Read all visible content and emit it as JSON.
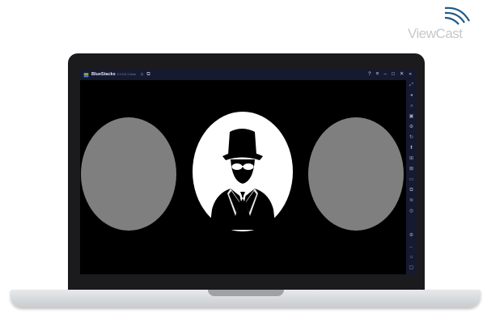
{
  "watermark": {
    "text": "ViewCast"
  },
  "window": {
    "title": "BlueStacks",
    "version": "5.9.110.1 Beta",
    "left_icons": [
      "home-icon",
      "multi-instance-icon"
    ],
    "right_icons": [
      "help-icon",
      "menu-icon",
      "minimize-icon",
      "maximize-icon",
      "close-icon",
      "collapse-sidebar-icon"
    ]
  },
  "sidebar": {
    "items": [
      {
        "name": "fullscreen-icon",
        "glyph": "⤢"
      },
      {
        "name": "volume-up-icon",
        "glyph": "◂"
      },
      {
        "name": "volume-down-icon",
        "glyph": "◃"
      },
      {
        "name": "media-icon",
        "glyph": "▣"
      },
      {
        "name": "settings-small-icon",
        "glyph": "⚙"
      },
      {
        "name": "rotate-icon",
        "glyph": "↻"
      },
      {
        "name": "apk-install-icon",
        "glyph": "⬆"
      },
      {
        "name": "screenshot-icon",
        "glyph": "⊞"
      },
      {
        "name": "shake-icon",
        "glyph": "⊠"
      },
      {
        "name": "folder-icon",
        "glyph": "▭"
      },
      {
        "name": "copy-icon",
        "glyph": "⧉"
      },
      {
        "name": "layers-icon",
        "glyph": "≋"
      },
      {
        "name": "eco-icon",
        "glyph": "◎"
      },
      {
        "name": "settings-icon",
        "glyph": "⚙"
      },
      {
        "name": "back-icon",
        "glyph": "←"
      },
      {
        "name": "home-nav-icon",
        "glyph": "⌂"
      },
      {
        "name": "recent-apps-icon",
        "glyph": "▢"
      }
    ]
  },
  "content": {
    "image": "spy-avatar-carousel",
    "colors": {
      "left_disc": "#7f7f7f",
      "right_disc": "#7f7f7f",
      "center_disc": "#ffffff",
      "figure": "#000000"
    }
  }
}
